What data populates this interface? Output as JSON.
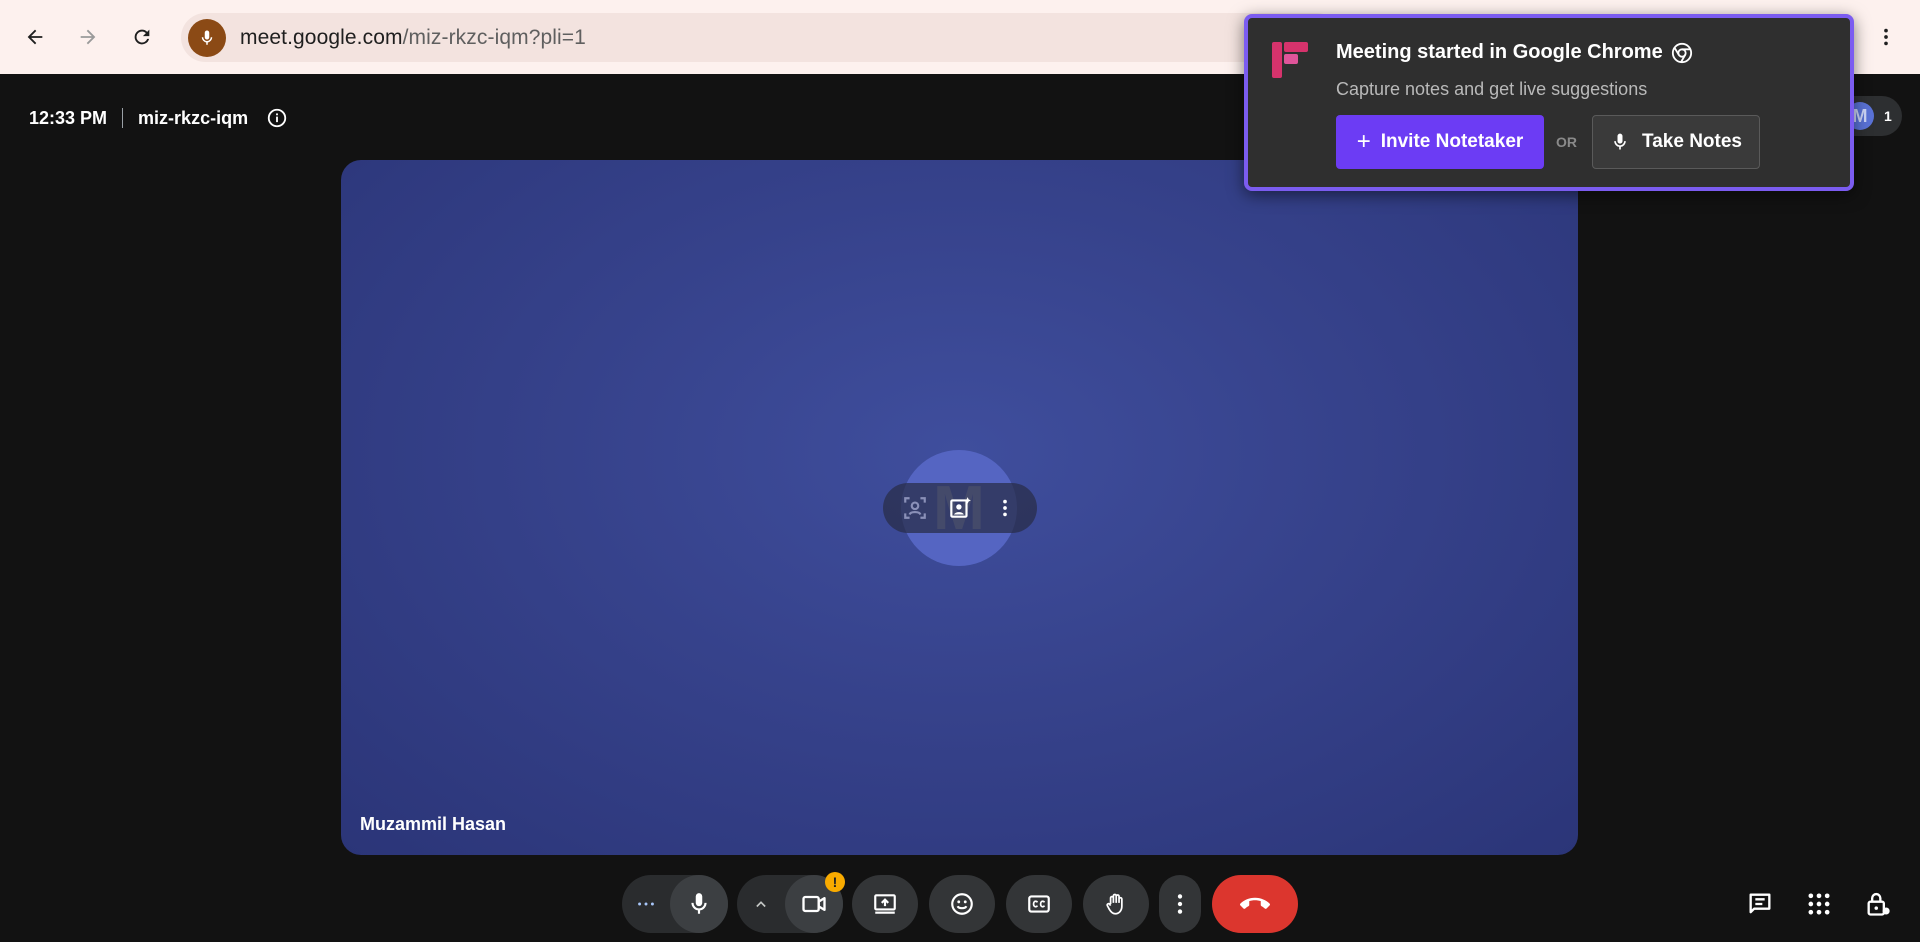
{
  "browser": {
    "url_host": "meet.google.com",
    "url_path": "/miz-rkzc-iqm?pli=1",
    "icons": [
      "back-icon",
      "forward-icon",
      "reload-icon",
      "microphone-icon",
      "more-vert-icon"
    ]
  },
  "meeting": {
    "time": "12:33 PM",
    "code": "miz-rkzc-iqm",
    "participant_count": "1",
    "participant_initial": "M"
  },
  "tile": {
    "avatar_initial": "M",
    "name": "Muzammil Hasan",
    "background_color": "#36428b"
  },
  "controls": {
    "warning_badge": "!",
    "items": [
      "more-options-icon",
      "microphone-icon",
      "chevron-up-icon",
      "camera-icon",
      "present-screen-icon",
      "emoji-icon",
      "captions-icon",
      "raise-hand-icon",
      "more-vert-icon",
      "end-call-icon"
    ],
    "end_call_color": "#dc362e",
    "right_tools": [
      "chat-icon",
      "apps-icon",
      "host-controls-icon"
    ]
  },
  "extension_popup": {
    "title": "Meeting started in Google Chrome",
    "subtitle": "Capture notes and get live suggestions",
    "invite_label": "Invite Notetaker",
    "invite_plus": "+",
    "or_label": "OR",
    "notes_label": "Take Notes",
    "accent_color": "#6c3cf4",
    "border_color": "#7b5cf0"
  }
}
